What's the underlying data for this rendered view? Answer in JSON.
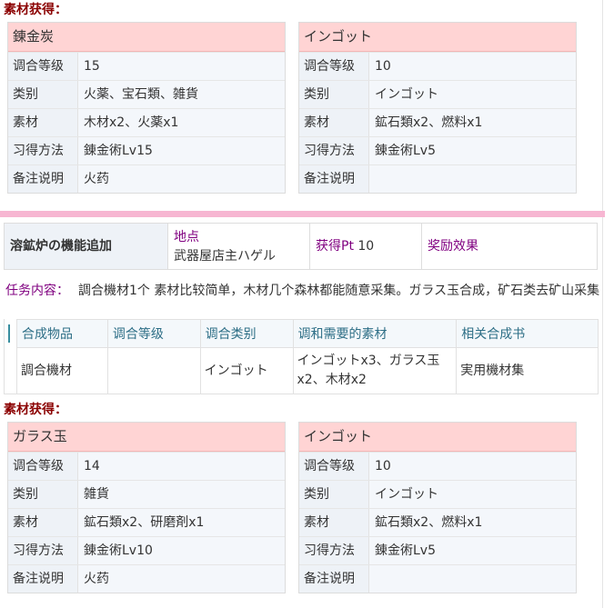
{
  "section_title": "素材获得：",
  "cards_top": [
    {
      "title": "錬金炭",
      "rows": [
        {
          "label": "调合等级",
          "value": "15"
        },
        {
          "label": "类别",
          "value": "火薬、宝石類、雑貨"
        },
        {
          "label": "素材",
          "value": "木材x2、火薬x1"
        },
        {
          "label": "习得方法",
          "value": "錬金術Lv15"
        },
        {
          "label": "备注说明",
          "value": "火药"
        }
      ]
    },
    {
      "title": "インゴット",
      "rows": [
        {
          "label": "调合等级",
          "value": "10"
        },
        {
          "label": "类别",
          "value": "インゴット"
        },
        {
          "label": "素材",
          "value": "鉱石類x2、燃料x1"
        },
        {
          "label": "习得方法",
          "value": "錬金術Lv5"
        },
        {
          "label": "备注说明",
          "value": ""
        }
      ]
    }
  ],
  "quest": {
    "name": "溶鉱炉の機能追加",
    "location_label": "地点",
    "location_value": "武器屋店主ハゲル",
    "pt_label": "获得Pt",
    "pt_value": "10",
    "reward_label": "奖励效果"
  },
  "task": {
    "label": "任务内容：",
    "text": "調合機材1个 素材比较简单，木材几个森林都能随意采集。ガラス玉合成，矿石类去矿山采集"
  },
  "synthesis": {
    "headers": [
      "合成物品",
      "调合等级",
      "调合类别",
      "调和需要的素材",
      "相关合成书"
    ],
    "row": [
      "調合機材",
      "",
      "インゴット",
      "インゴットx3、ガラス玉x2、木材x2",
      "実用機材集"
    ]
  },
  "section_title_2": "素材获得：",
  "cards_bottom": [
    {
      "title": "ガラス玉",
      "rows": [
        {
          "label": "调合等级",
          "value": "14"
        },
        {
          "label": "类别",
          "value": "雑貨"
        },
        {
          "label": "素材",
          "value": "鉱石類x2、研磨剤x1"
        },
        {
          "label": "习得方法",
          "value": "錬金術Lv10"
        },
        {
          "label": "备注说明",
          "value": "火药"
        }
      ]
    },
    {
      "title": "インゴット",
      "rows": [
        {
          "label": "调合等级",
          "value": "10"
        },
        {
          "label": "类别",
          "value": "インゴット"
        },
        {
          "label": "素材",
          "value": "鉱石類x2、燃料x1"
        },
        {
          "label": "习得方法",
          "value": "錬金術Lv5"
        },
        {
          "label": "备注说明",
          "value": ""
        }
      ]
    }
  ]
}
